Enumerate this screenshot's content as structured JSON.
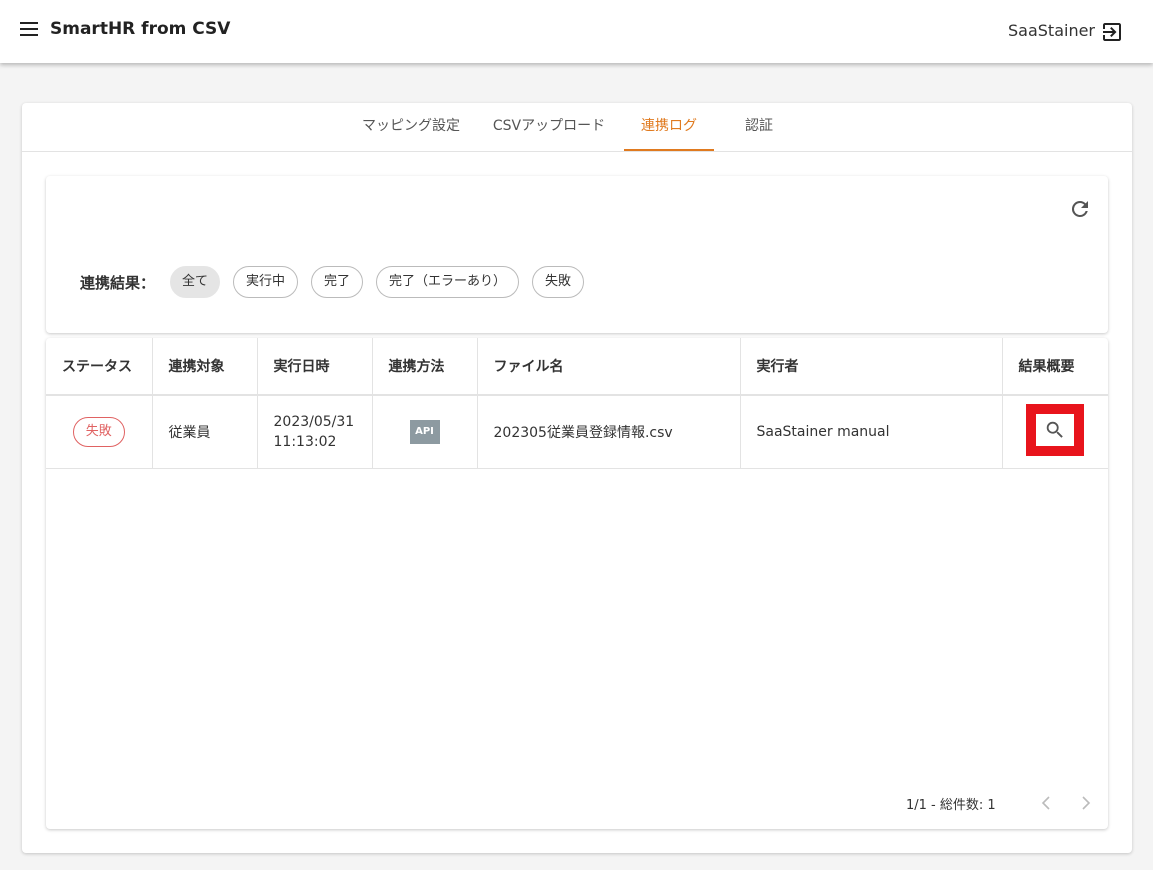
{
  "header": {
    "title": "SmartHR from CSV",
    "user": "SaaStainer"
  },
  "tabs": [
    {
      "label": "マッピング設定",
      "active": false
    },
    {
      "label": "CSVアップロード",
      "active": false
    },
    {
      "label": "連携ログ",
      "active": true
    },
    {
      "label": "認証",
      "active": false
    }
  ],
  "filter": {
    "label": "連携結果：",
    "chips": [
      {
        "label": "全て",
        "selected": true
      },
      {
        "label": "実行中",
        "selected": false
      },
      {
        "label": "完了",
        "selected": false
      },
      {
        "label": "完了（エラーあり）",
        "selected": false
      },
      {
        "label": "失敗",
        "selected": false
      }
    ]
  },
  "table": {
    "columns": [
      "ステータス",
      "連携対象",
      "実行日時",
      "連携方法",
      "ファイル名",
      "実行者",
      "結果概要"
    ],
    "rows": [
      {
        "status": "失敗",
        "target": "従業員",
        "date": "2023/05/31",
        "time": "11:13:02",
        "method": "API",
        "filename": "202305従業員登録情報.csv",
        "executor": "SaaStainer manual"
      }
    ]
  },
  "pagination": {
    "text": "1/1 - 総件数: 1"
  },
  "colors": {
    "accent": "#e07a1f",
    "status_failed": "#e06262",
    "highlight": "#e8141c",
    "api_badge": "#8d9aa1"
  }
}
